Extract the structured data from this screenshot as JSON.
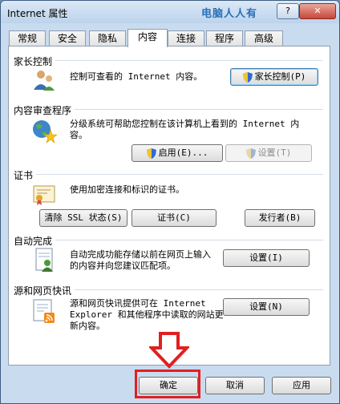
{
  "window": {
    "title": "Internet 属性",
    "watermark": "电脑人人有",
    "help_label": "?",
    "close_label": "✕"
  },
  "tabs": [
    {
      "label": "常规"
    },
    {
      "label": "安全"
    },
    {
      "label": "隐私"
    },
    {
      "label": "内容",
      "active": true
    },
    {
      "label": "连接"
    },
    {
      "label": "程序"
    },
    {
      "label": "高级"
    }
  ],
  "sections": {
    "parental": {
      "title": "家长控制",
      "text": "控制可查看的 Internet 内容。",
      "button": "家长控制(P)",
      "icon": "parental-control-icon"
    },
    "advisor": {
      "title": "内容审查程序",
      "text": "分级系统可帮助您控制在该计算机上看到的 Internet 内容。",
      "enable_button": "启用(E)...",
      "settings_button": "设置(T)",
      "icon": "content-advisor-icon"
    },
    "certificates": {
      "title": "证书",
      "text": "使用加密连接和标识的证书。",
      "clear_ssl_button": "清除 SSL 状态(S)",
      "certificates_button": "证书(C)",
      "publishers_button": "发行者(B)",
      "icon": "certificate-icon"
    },
    "autocomplete": {
      "title": "自动完成",
      "text": "自动完成功能存储以前在网页上输入的内容并向您建议匹配项。",
      "button": "设置(I)",
      "icon": "autocomplete-icon"
    },
    "feeds": {
      "title": "源和网页快讯",
      "text": "源和网页快讯提供可在 Internet Explorer 和其他程序中读取的网站更新内容。",
      "button": "设置(N)",
      "icon": "feeds-icon"
    }
  },
  "footer": {
    "ok_label": "确定",
    "cancel_label": "取消",
    "apply_label": "应用"
  },
  "colors": {
    "highlight_box": "#e02020",
    "arrow": "#e02020"
  }
}
